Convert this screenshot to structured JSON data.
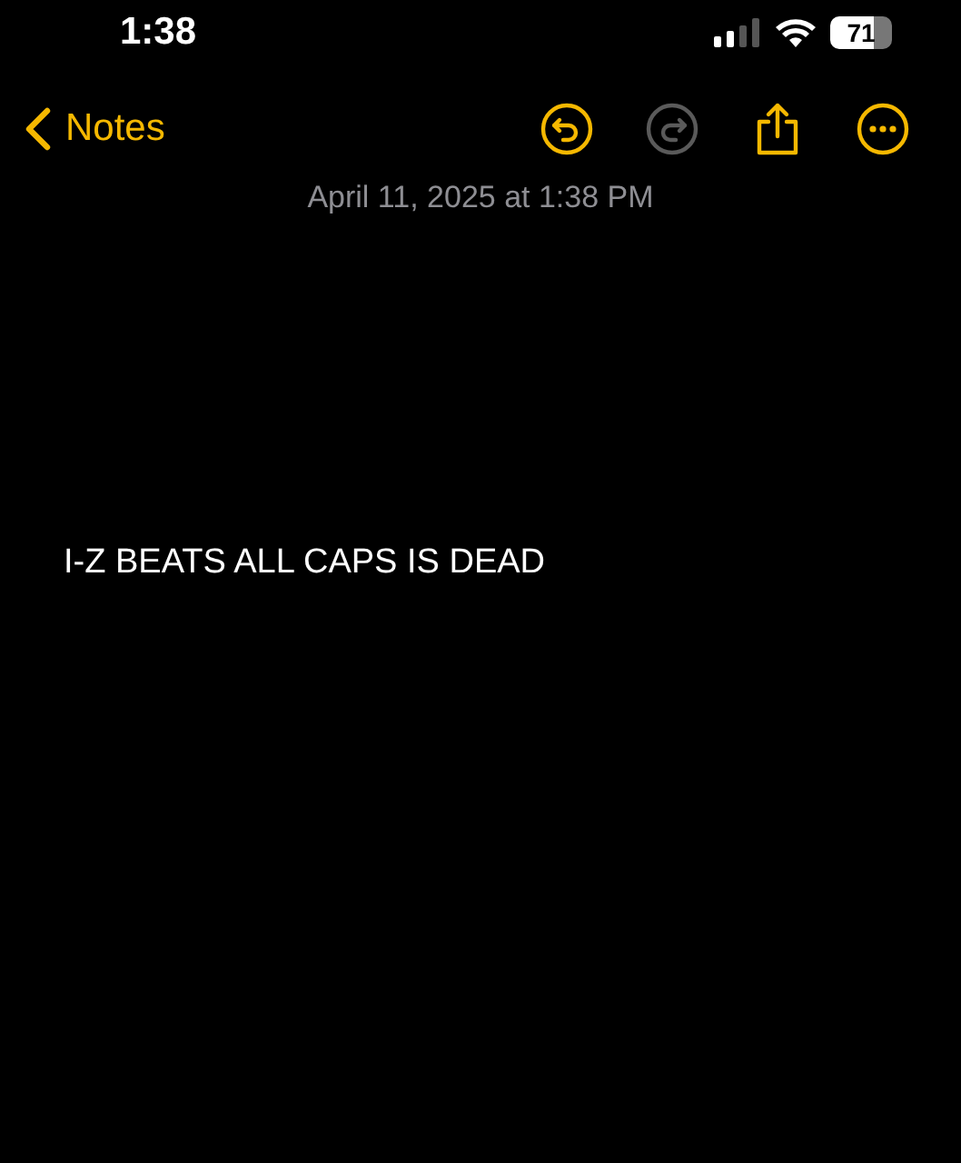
{
  "status_bar": {
    "time": "1:38",
    "battery": "71"
  },
  "nav": {
    "back_label": "Notes",
    "buttons": [
      {
        "kind": "undo",
        "disabled": false
      },
      {
        "kind": "redo",
        "disabled": true
      },
      {
        "kind": "share",
        "disabled": false
      },
      {
        "kind": "more",
        "disabled": false
      }
    ]
  },
  "date": "April 11, 2025 at 1:38 PM",
  "body": "I-Z BEATS ALL CAPS IS DEAD"
}
